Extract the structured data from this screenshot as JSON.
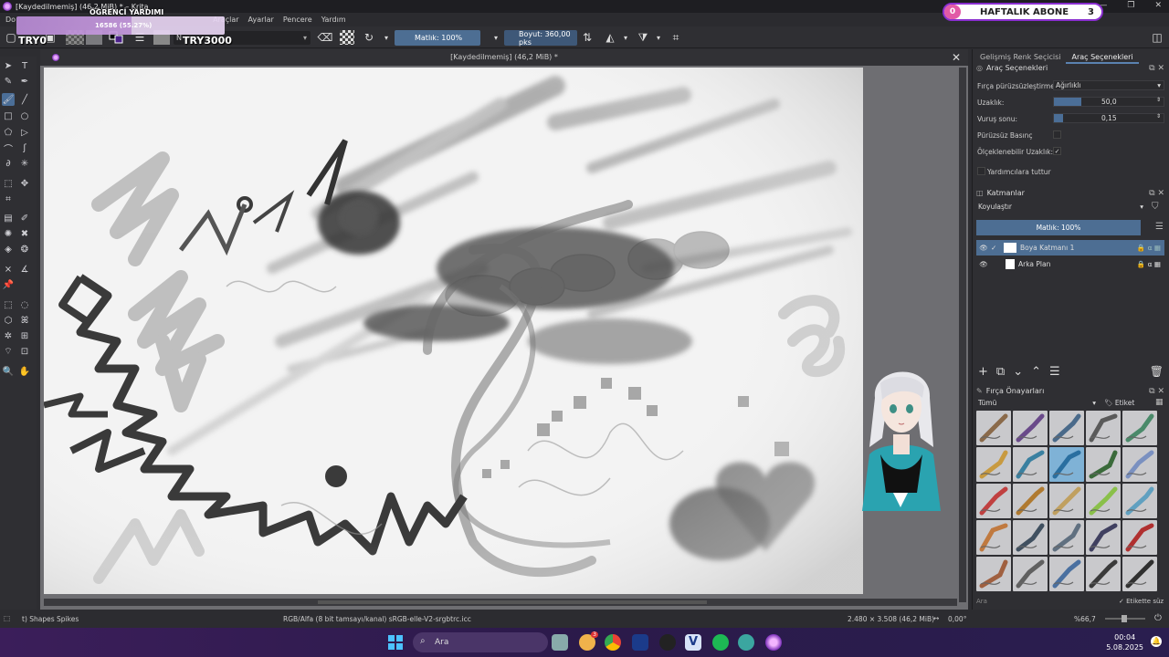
{
  "window": {
    "title": "[Kaydedilmemiş]  (46,2 MiB) * – Krita"
  },
  "menu": {
    "items": [
      "Do",
      "Araçlar",
      "Ayarlar",
      "Pencere",
      "Yardım"
    ]
  },
  "overlay": {
    "title": "ÖĞRENCİ YARDIMI",
    "progress_text": "16586 (55.27%)",
    "progress": 0.5527,
    "left_label": "TRY0",
    "right_label": "TRY3000"
  },
  "weekly": {
    "left_count": "0",
    "label": "HAFTALIK ABONE",
    "right_count": "3"
  },
  "toolbar": {
    "opacity": "Matlık: 100%",
    "size": "Boyut: 360,00 pks",
    "brush_name": "N"
  },
  "document": {
    "tab_title": "[Kaydedilmemiş]  (46,2 MiB) *"
  },
  "dock": {
    "tabs": [
      "Gelişmiş Renk Seçicisi",
      "Araç Seçenekleri"
    ],
    "tool_options": {
      "title": "Araç Seçenekleri",
      "smoothing_label": "Fırça pürüzsüzleştirme:",
      "smoothing_value": "Ağırlıklı",
      "distance_label": "Uzaklık:",
      "distance_value": "50,0",
      "distance_fill": 0.25,
      "stroke_end_label": "Vuruş sonu:",
      "stroke_end_value": "0,15",
      "stroke_end_fill": 0.08,
      "pressure_label": "Pürüzsüz Basınç",
      "scalable_label": "Ölçeklenebilir Uzaklık:",
      "assist_label": "Yardımcılara tuttur"
    },
    "layers": {
      "title": "Katmanlar",
      "blend": "Koyulaştır",
      "opacity": "Matlık:  100%",
      "items": [
        {
          "name": "Boya Katmanı 1"
        },
        {
          "name": "Arka Plan"
        }
      ]
    },
    "presets": {
      "title": "Fırça Önayarları",
      "filter": "Tümü",
      "tag": "Etiket",
      "search_placeholder": "Ara",
      "hide_label": "Etikette süz"
    }
  },
  "status": {
    "brush": "t) Shapes Spikes",
    "color": "RGB/Alfa (8 bit tamsayı/kanal) sRGB-elle-V2-srgbtrc.icc",
    "dims": "2.480 × 3.508 (46,2 MiB)",
    "rotation": "0,00°",
    "zoom": "%66,7"
  },
  "taskbar": {
    "search": "Ara",
    "time": "00:04",
    "date": "5.08.2025",
    "badge": "3"
  }
}
